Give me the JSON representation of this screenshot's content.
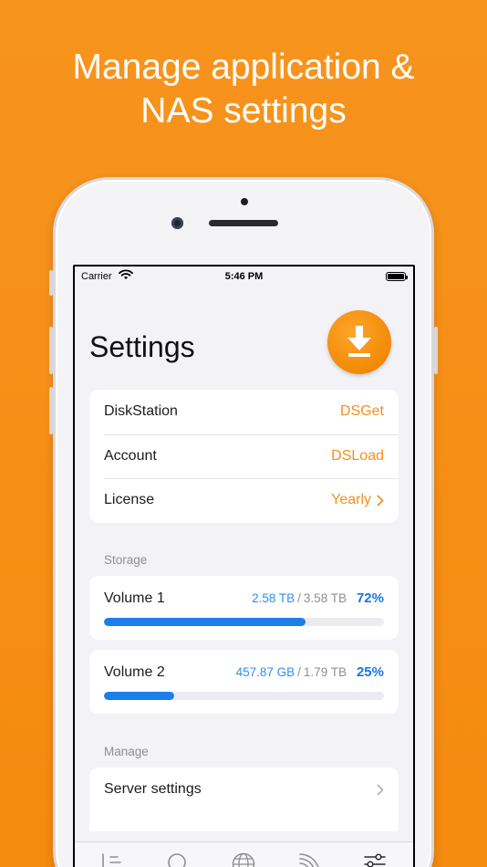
{
  "headline": {
    "line1": "Manage application &",
    "line2": "NAS settings"
  },
  "statusbar": {
    "carrier": "Carrier",
    "time": "5:46 PM"
  },
  "title": "Settings",
  "account_rows": [
    {
      "label": "DiskStation",
      "value": "DSGet",
      "chevron": false
    },
    {
      "label": "Account",
      "value": "DSLoad",
      "chevron": false
    },
    {
      "label": "License",
      "value": "Yearly",
      "chevron": true
    }
  ],
  "storage": {
    "section_label": "Storage",
    "volumes": [
      {
        "name": "Volume 1",
        "used": "2.58 TB",
        "separator": "/",
        "total": "3.58 TB",
        "percent_label": "72%",
        "percent": 72
      },
      {
        "name": "Volume 2",
        "used": "457.87 GB",
        "separator": "/",
        "total": "1.79 TB",
        "percent_label": "25%",
        "percent": 25
      }
    ]
  },
  "manage": {
    "section_label": "Manage",
    "rows": [
      {
        "label": "Server settings",
        "chevron": true
      }
    ]
  },
  "tabs": [
    {
      "icon": "sort-list-icon"
    },
    {
      "icon": "search-icon"
    },
    {
      "icon": "globe-icon"
    },
    {
      "icon": "rss-icon"
    },
    {
      "icon": "sliders-icon"
    }
  ],
  "colors": {
    "accent": "#F2901C",
    "progress": "#1A7FE8",
    "background": "#F7941D"
  }
}
